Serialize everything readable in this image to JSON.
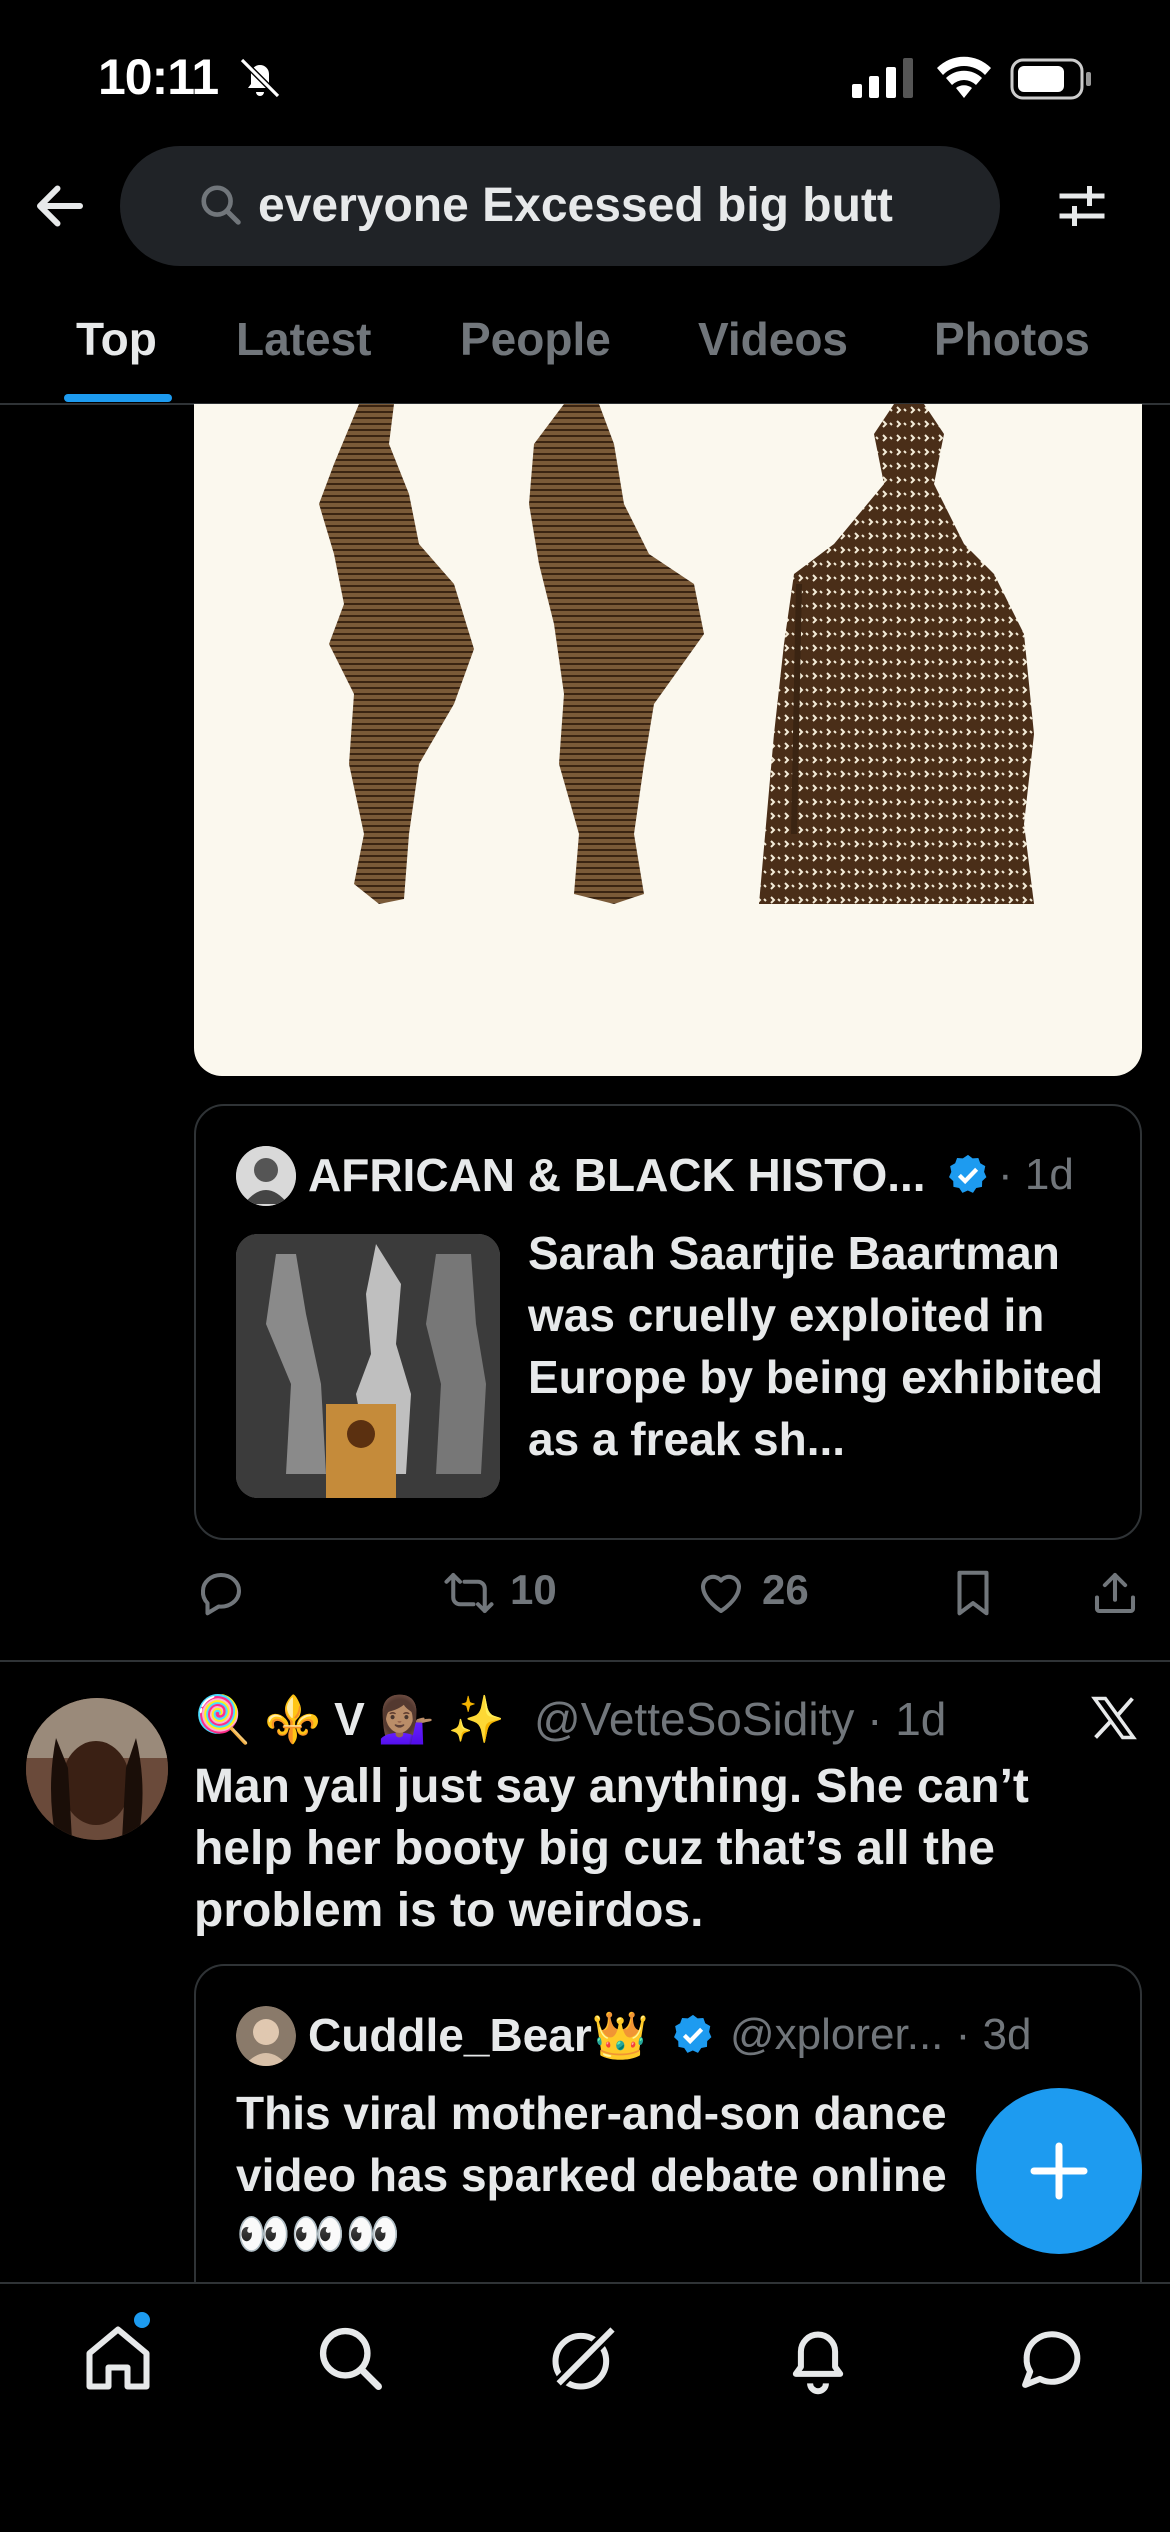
{
  "status_bar": {
    "time": "10:11"
  },
  "search": {
    "query": "everyone Excessed big butt"
  },
  "tabs": [
    {
      "label": "Top",
      "active": true
    },
    {
      "label": "Latest",
      "active": false
    },
    {
      "label": "People",
      "active": false
    },
    {
      "label": "Videos",
      "active": false
    },
    {
      "label": "Photos",
      "active": false
    }
  ],
  "tweet1": {
    "quote": {
      "name": "AFRICAN & BLACK HISTO...",
      "meta": "· 1d",
      "text": "Sarah Saartjie Baartman was cruelly exploited in Europe by being exhibited as a freak sh..."
    },
    "actions": {
      "reply": "",
      "retweets": "10",
      "likes": "26"
    }
  },
  "tweet2": {
    "display_name": "🍭 ⚜️ V 💁🏽‍♀️ ✨",
    "meta": "@VetteSoSidity · 1d",
    "text": "Man yall just say anything. She can’t help her booty big cuz that’s all the problem is to weirdos.",
    "quote": {
      "name": "Cuddle_Bear👑",
      "meta": "@xplorer... · 3d",
      "text": "This viral mother-and-son dance video has sparked debate online",
      "eyes": "👀👀👀"
    }
  },
  "colors": {
    "accent": "#1d9bf0",
    "muted": "#71767b",
    "background": "#000000"
  }
}
